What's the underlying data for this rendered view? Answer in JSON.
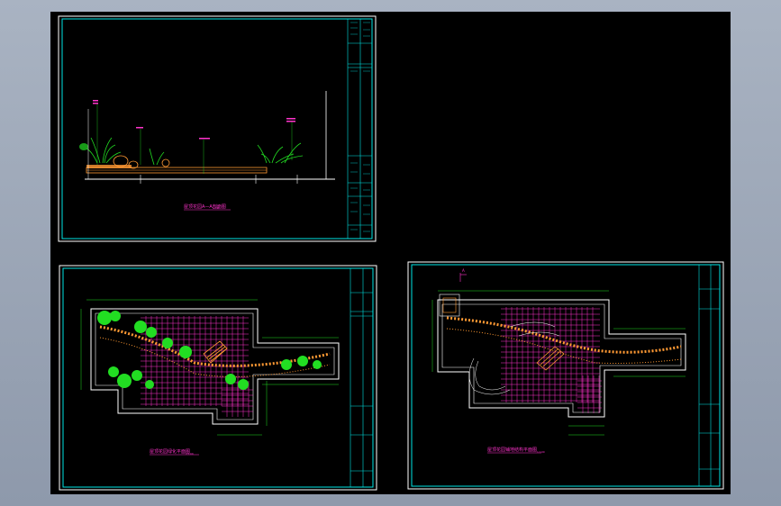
{
  "sheets": [
    {
      "id": "elevation",
      "title": "屋顶花园A—A剖面图",
      "scale": "1:50"
    },
    {
      "id": "planting-plan",
      "title": "屋顶花园绿化平面图",
      "scale": "1:100"
    },
    {
      "id": "paving-plan",
      "title": "屋顶花园铺地结构平面图",
      "scale": "1:100",
      "section_mark": "A"
    }
  ],
  "colors": {
    "background": "#000000",
    "frame": "#00e5e5",
    "outline": "#ffffff",
    "paving": "#ff33cc",
    "plants": "#22dd22",
    "stones": "#ff9933",
    "dimension": "#22dd22"
  }
}
